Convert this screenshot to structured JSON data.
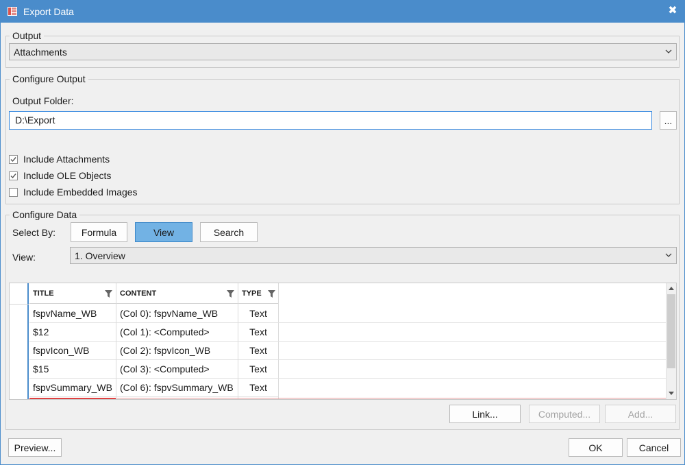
{
  "window": {
    "title": "Export Data",
    "close_glyph": "✖"
  },
  "output": {
    "legend": "Output",
    "selected": "Attachments"
  },
  "configure_output": {
    "legend": "Configure Output",
    "folder_label": "Output Folder:",
    "folder_value": "D:\\Export",
    "browse_label": "...",
    "checks": [
      {
        "label": "Include Attachments",
        "checked": true
      },
      {
        "label": "Include OLE Objects",
        "checked": true
      },
      {
        "label": "Include Embedded Images",
        "checked": false
      }
    ]
  },
  "configure_data": {
    "legend": "Configure Data",
    "select_by_label": "Select By:",
    "select_by_buttons": [
      "Formula",
      "View",
      "Search"
    ],
    "active_select_by": "View",
    "view_label": "View:",
    "view_selected": "1. Overview",
    "columns": [
      "TITLE",
      "CONTENT",
      "TYPE"
    ],
    "rows": [
      [
        "fspvName_WB",
        "(Col 0): fspvName_WB",
        "Text"
      ],
      [
        "$12",
        "(Col 1): <Computed>",
        "Text"
      ],
      [
        "fspvIcon_WB",
        "(Col 2): fspvIcon_WB",
        "Text"
      ],
      [
        "$15",
        "(Col 3): <Computed>",
        "Text"
      ],
      [
        "fspvSummary_WB",
        "(Col 6): fspvSummary_WB",
        "Text"
      ]
    ],
    "link_button": "Link...",
    "computed_button": "Computed...",
    "add_button": "Add..."
  },
  "footer": {
    "preview_button": "Preview...",
    "ok_button": "OK",
    "cancel_button": "Cancel"
  },
  "colors": {
    "titlebar": "#4a8ccb",
    "active_button": "#72b2e4"
  },
  "icons": [
    "app-icon",
    "close-icon",
    "chevron-down-icon",
    "filter-icon",
    "checkmark-icon",
    "scroll-up-icon",
    "scroll-down-icon"
  ]
}
